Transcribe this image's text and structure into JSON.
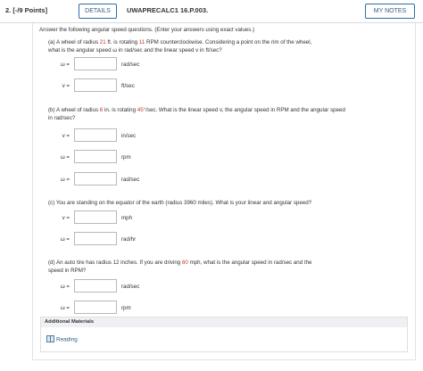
{
  "header": {
    "question_number": "2. [-/9 Points]",
    "details_label": "DETAILS",
    "question_code": "UWAPRECALC1 16.P.003.",
    "my_notes_label": "MY NOTES"
  },
  "intro": "Answer the following angular speed questions. (Enter your answers using exact values.)",
  "part_a": {
    "text_1": "(a) A wheel of radius ",
    "radius": "21",
    "text_2": " ft. is rotating ",
    "rpm": "11",
    "text_3": " RPM counterclockwise. Considering a point on the rim of the wheel,",
    "line_2": "what is the angular speed ω in rad/sec and the linear speed v in ft/sec?",
    "fields": [
      {
        "label": "ω =",
        "unit": "rad/sec"
      },
      {
        "label": "v =",
        "unit": "ft/sec"
      }
    ]
  },
  "part_b": {
    "text_1": "(b) A wheel of radius ",
    "radius": "6",
    "text_2": " in. is rotating ",
    "rate": "45°",
    "text_3": "/sec. What is the linear speed v, the angular speed in RPM and the angular speed",
    "line_2": "in rad/sec?",
    "fields": [
      {
        "label": "v =",
        "unit": "in/sec"
      },
      {
        "label": "ω =",
        "unit": "rpm"
      },
      {
        "label": "ω =",
        "unit": "rad/sec"
      }
    ]
  },
  "part_c": {
    "text": "(c) You are standing on the equator of the earth (radius 3960 miles). What is your linear and angular speed?",
    "fields": [
      {
        "label": "v =",
        "unit": "mph"
      },
      {
        "label": "ω =",
        "unit": "rad/hr"
      }
    ]
  },
  "part_d": {
    "text_1": "(d) An auto tire has radius 12 inches. If you are driving ",
    "speed": "60",
    "text_2": " mph, what is the angular speed in rad/sec and the",
    "line_2": "speed in RPM?",
    "fields": [
      {
        "label": "ω =",
        "unit": "rad/sec"
      },
      {
        "label": "ω =",
        "unit": "rpm"
      }
    ]
  },
  "additional_materials": {
    "heading": "Additional Materials",
    "link_label": "Reading",
    "link_icon": "book-icon"
  },
  "colors": {
    "accent_blue": "#2e5f8a",
    "highlight_red": "#c0392b"
  }
}
